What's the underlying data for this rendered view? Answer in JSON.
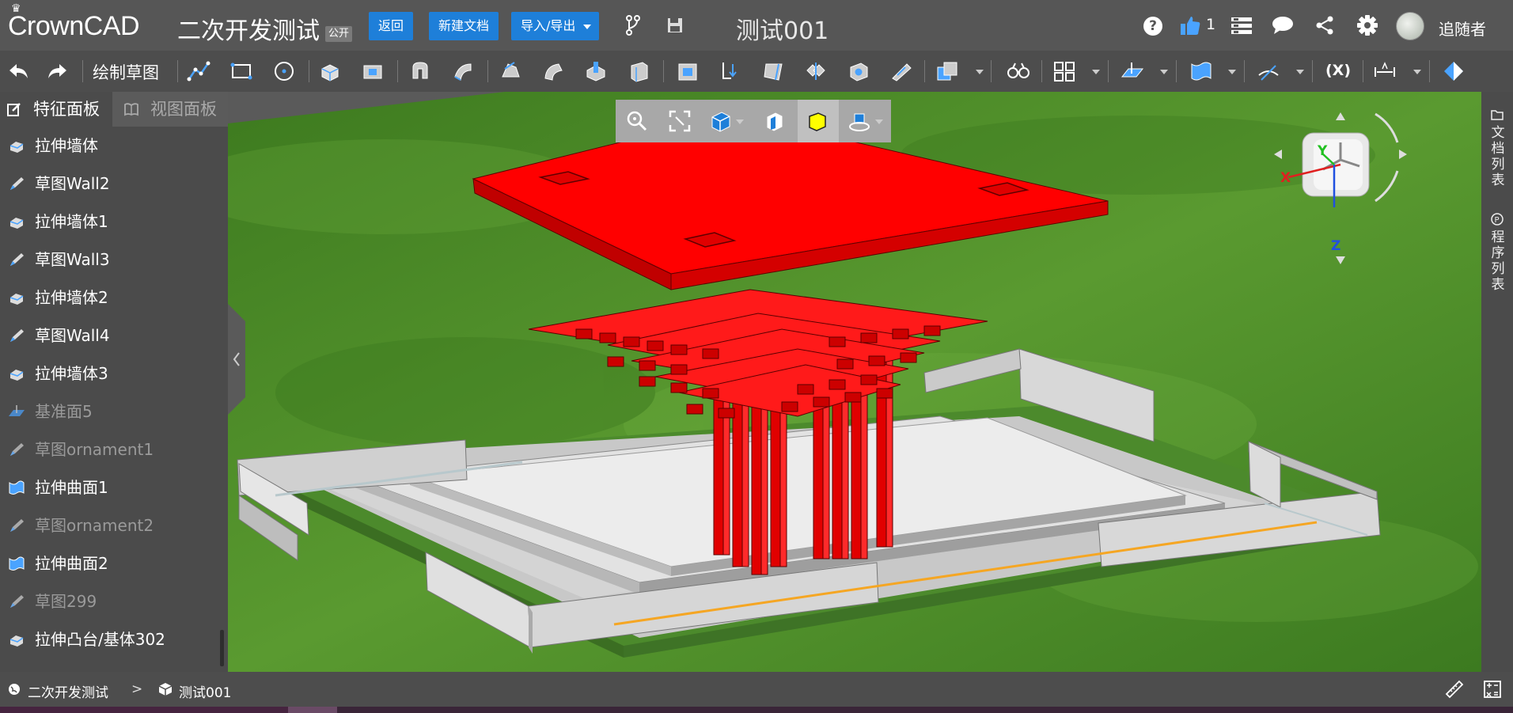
{
  "header": {
    "app_name": "CrownCAD",
    "doc_group": "二次开发测试",
    "public_badge": "公开",
    "back_label": "返回",
    "new_doc_label": "新建文档",
    "import_export_label": "导入/导出",
    "doc_title": "测试001",
    "help_glyph": "?",
    "like_count": "1",
    "username": "追随者"
  },
  "toolbar": {
    "sketch_label": "绘制草图",
    "parametric_label": "(X)",
    "icons": [
      "undo-icon",
      "redo-icon",
      "polyline-icon",
      "rectangle-icon",
      "circle-icon",
      "extrude-icon",
      "cut-icon",
      "revolve-icon",
      "sweep-icon",
      "loft-icon",
      "fillet-icon",
      "chamfer-icon",
      "shell-icon",
      "draft-icon",
      "boolean-icon",
      "pattern-icon",
      "mirror-icon",
      "measure-icon",
      "layout-icon",
      "plane-icon",
      "surface-icon",
      "axis-icon",
      "dimension-icon",
      "appearance-icon"
    ]
  },
  "left_panel": {
    "tabs": [
      {
        "label": "特征面板",
        "active": true
      },
      {
        "label": "视图面板",
        "active": false
      }
    ],
    "features": [
      {
        "label": "拉伸墙体",
        "icon": "extrude-wall-icon",
        "dim": false
      },
      {
        "label": "草图Wall2",
        "icon": "sketch-icon",
        "dim": false
      },
      {
        "label": "拉伸墙体1",
        "icon": "extrude-wall-icon",
        "dim": false
      },
      {
        "label": "草图Wall3",
        "icon": "sketch-icon",
        "dim": false
      },
      {
        "label": "拉伸墙体2",
        "icon": "extrude-wall-icon",
        "dim": false
      },
      {
        "label": "草图Wall4",
        "icon": "sketch-icon",
        "dim": false
      },
      {
        "label": "拉伸墙体3",
        "icon": "extrude-wall-icon",
        "dim": false
      },
      {
        "label": "基准面5",
        "icon": "plane-icon",
        "dim": true
      },
      {
        "label": "草图ornament1",
        "icon": "sketch-icon",
        "dim": true
      },
      {
        "label": "拉伸曲面1",
        "icon": "surface-icon",
        "dim": false
      },
      {
        "label": "草图ornament2",
        "icon": "sketch-icon",
        "dim": true
      },
      {
        "label": "拉伸曲面2",
        "icon": "surface-icon",
        "dim": false
      },
      {
        "label": "草图299",
        "icon": "sketch-icon",
        "dim": true
      },
      {
        "label": "拉伸凸台/基体302",
        "icon": "extrude-boss-icon",
        "dim": false
      }
    ]
  },
  "right_panel": {
    "doc_list_label": "文档列表",
    "program_list_label": "程序列表"
  },
  "view_tools": [
    "zoom-icon",
    "fit-icon",
    "view-cube-icon",
    "section-view-icon",
    "shaded-icon",
    "render-mode-icon"
  ],
  "view_cube": {
    "x_label": "X",
    "y_label": "Y",
    "z_label": "Z"
  },
  "status_bar": {
    "group": "二次开发测试",
    "separator": ">",
    "doc": "测试001"
  },
  "colors": {
    "accent": "#1e7fd9",
    "model_red": "#ff0000",
    "grass": "#4a8a2a",
    "stripe": "#f5a623"
  }
}
